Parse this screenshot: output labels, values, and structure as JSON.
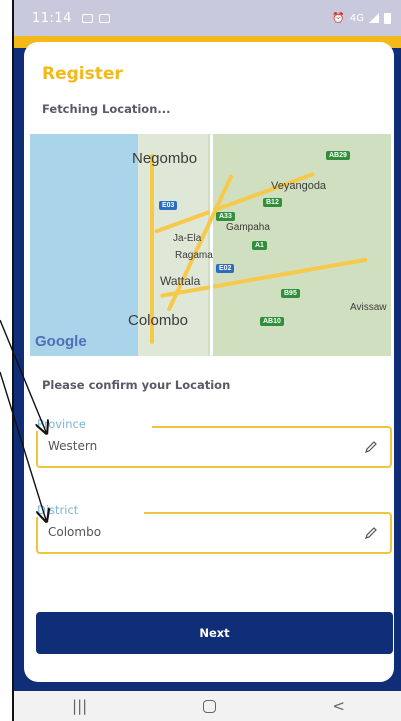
{
  "status_bar": {
    "time": "11:14",
    "network": "4G",
    "icons": [
      "gallery-icon",
      "message-icon",
      "alarm-icon",
      "signal-icon",
      "battery-icon"
    ]
  },
  "page": {
    "title": "Register",
    "status_text": "Fetching Location...",
    "confirm_text": "Please confirm your Location"
  },
  "map": {
    "attribution": "Google",
    "places": [
      "Negombo",
      "Veyangoda",
      "Gampaha",
      "Ja-Ela",
      "Ragama",
      "Wattala",
      "Colombo",
      "Avissaw"
    ],
    "road_shields": [
      "AB29",
      "E03",
      "B12",
      "A33",
      "A1",
      "E02",
      "B95",
      "AB10"
    ]
  },
  "form": {
    "province": {
      "label": "Province",
      "value": "Western"
    },
    "district": {
      "label": "District",
      "value": "Colombo"
    }
  },
  "actions": {
    "next_label": "Next"
  },
  "nav_bar": {
    "recent": "|||",
    "back": "<"
  },
  "colors": {
    "accent": "#f2b918",
    "primary": "#0f2e77",
    "label": "#78b6d6"
  }
}
